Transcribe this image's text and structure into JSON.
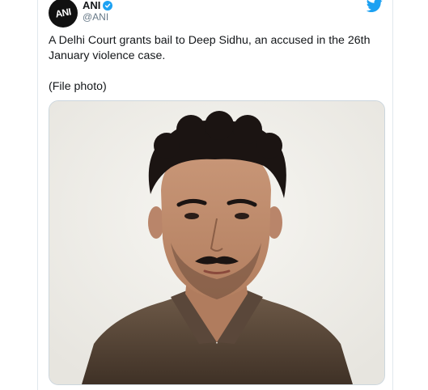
{
  "tweet": {
    "author_name": "ANI",
    "author_handle": "@ANI",
    "avatar_logo_text": "ANI",
    "paragraphs": [
      "A Delhi Court grants bail to Deep Sidhu, an accused in the 26th January violence case.",
      "(File photo)"
    ]
  },
  "colors": {
    "accent": "#1da1f2",
    "text": "#14171a",
    "secondary_text": "#657786"
  },
  "icons": [
    "twitter-bird-icon",
    "verified-badge-icon"
  ]
}
